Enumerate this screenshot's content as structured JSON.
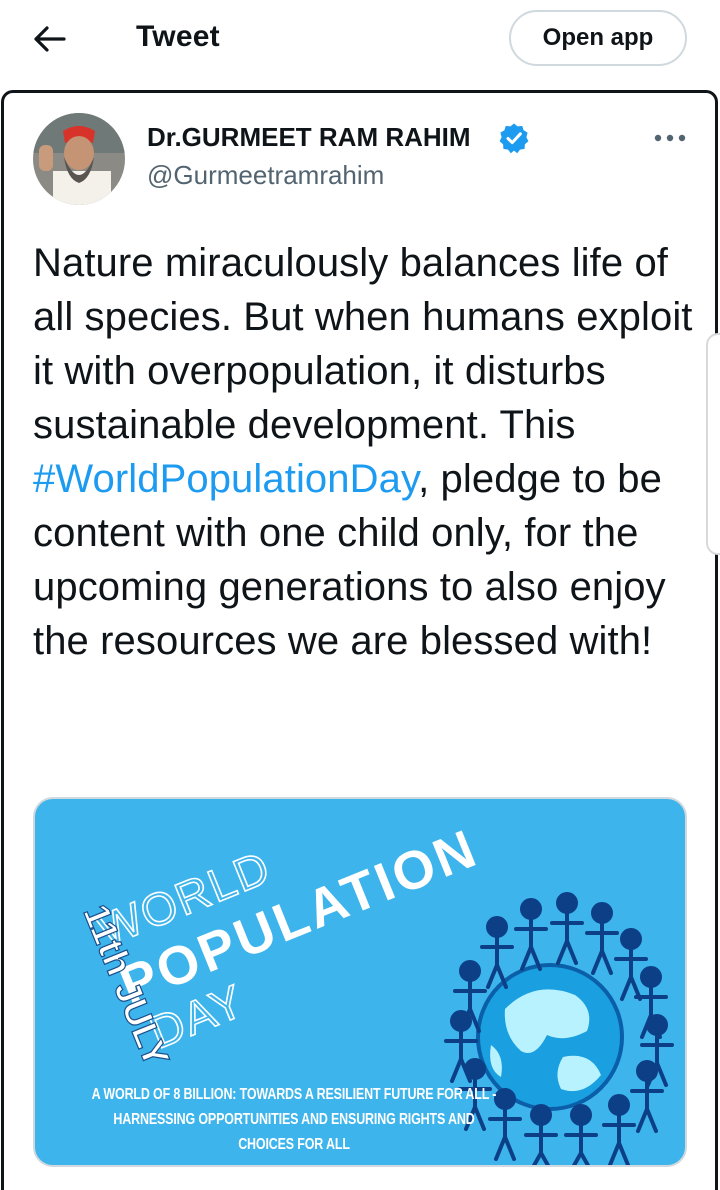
{
  "header": {
    "title": "Tweet",
    "open_app_label": "Open app"
  },
  "tweet": {
    "author_name": "Dr.GURMEET RAM RAHIM",
    "author_handle": "@Gurmeetramrahim",
    "text_before_hashtag": "Nature miraculously balances life of all species. But when humans exploit it with overpopulation, it disturbs sustainable development. This ",
    "hashtag": "#WorldPopulationDay",
    "text_after_hashtag": ", pledge to be content with one child only, for the upcoming generations to also enjoy the resources we are blessed with!"
  },
  "media": {
    "date": "11th JULY",
    "title_line1": "WORLD",
    "title_line2": "POPULATION",
    "title_line3": "DAY",
    "caption_line1": "A WORLD OF 8 BILLION: TOWARDS A RESILIENT FUTURE FOR ALL -",
    "caption_line2": "HARNESSING OPPORTUNITIES AND ENSURING RIGHTS AND",
    "caption_line3": "CHOICES FOR ALL"
  },
  "colors": {
    "link_blue": "#1d9bf0",
    "media_background": "#3db4ec",
    "secondary_text": "#536471"
  },
  "icons": {
    "back": "arrow-left-icon",
    "verified": "verified-badge-icon",
    "more": "more-horizontal-icon"
  }
}
